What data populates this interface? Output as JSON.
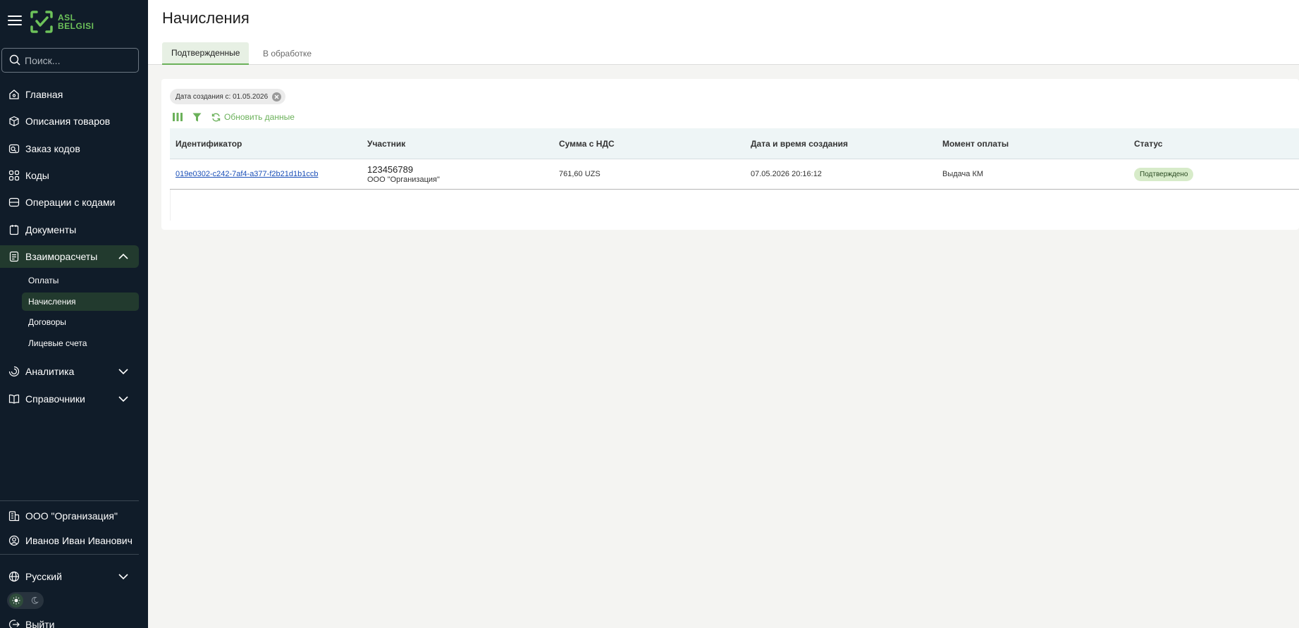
{
  "sidebar": {
    "logo_text_line1": "ASL",
    "logo_text_line2": "BELGISI",
    "search_placeholder": "Поиск...",
    "items": [
      {
        "label": "Главная",
        "icon": "home-icon"
      },
      {
        "label": "Описания товаров",
        "icon": "box-icon"
      },
      {
        "label": "Заказ кодов",
        "icon": "code-order-icon"
      },
      {
        "label": "Коды",
        "icon": "codes-icon"
      },
      {
        "label": "Операции с кодами",
        "icon": "operations-icon"
      },
      {
        "label": "Документы",
        "icon": "document-icon"
      },
      {
        "label": "Взаиморасчеты",
        "icon": "settlements-icon",
        "expanded": true
      },
      {
        "label": "Аналитика",
        "icon": "analytics-icon"
      },
      {
        "label": "Справочники",
        "icon": "book-icon"
      }
    ],
    "sub_items": [
      "Оплаты",
      "Начисления",
      "Договоры",
      "Лицевые счета"
    ],
    "active_sub_item": "Начисления",
    "organization": "ООО \"Организация\"",
    "user": "Иванов Иван Иванович",
    "language": "Русский",
    "theme": "light",
    "logout": "Выйти"
  },
  "header": {
    "title": "Начисления",
    "tabs": [
      "Подтвержденные",
      "В обработке"
    ],
    "active_tab": "Подтвержденные"
  },
  "filters": {
    "chip": "Дата создания с: 01.05.2026",
    "refresh_label": "Обновить данные"
  },
  "table": {
    "columns": [
      "Идентификатор",
      "Участник",
      "Сумма с НДС",
      "Дата и время создания",
      "Момент оплаты",
      "Статус"
    ],
    "rows": [
      {
        "id": "019e0302-c242-7af4-a377-f2b21d1b1ccb",
        "participant_inn": "123456789",
        "participant_name": "ООО \"Организация\"",
        "amount": "761,60 UZS",
        "created": "07.05.2026 20:16:12",
        "payment_moment": "Выдача КМ",
        "status": "Подтверждено"
      }
    ]
  },
  "colors": {
    "sidebar_bg": "#101c29",
    "accent": "#6bb15a",
    "active_item_bg": "#223a2e",
    "status_badge_bg": "#d7ebc9",
    "link": "#1a4fb8"
  }
}
